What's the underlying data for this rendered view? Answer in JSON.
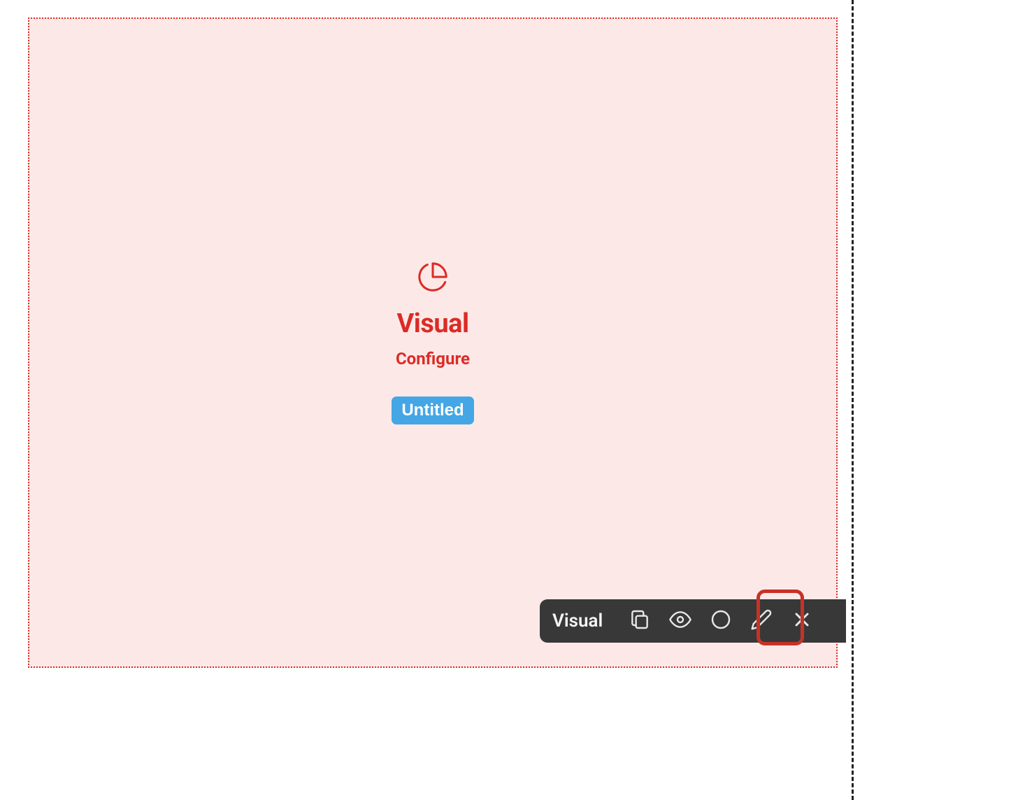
{
  "canvas": {
    "title": "Visual",
    "subtitle": "Configure",
    "chip_label": "Untitled"
  },
  "toolbar": {
    "label": "Visual",
    "icons": {
      "copy": "copy-icon",
      "eye": "eye-icon",
      "circle": "circle-icon",
      "pencil": "pencil-icon",
      "close": "close-icon"
    }
  },
  "colors": {
    "accent_red": "#dc2b26",
    "bg_pink": "#fce9e7",
    "chip_blue": "#44a6e5",
    "toolbar_bg": "#383838",
    "highlight": "#c63228"
  }
}
